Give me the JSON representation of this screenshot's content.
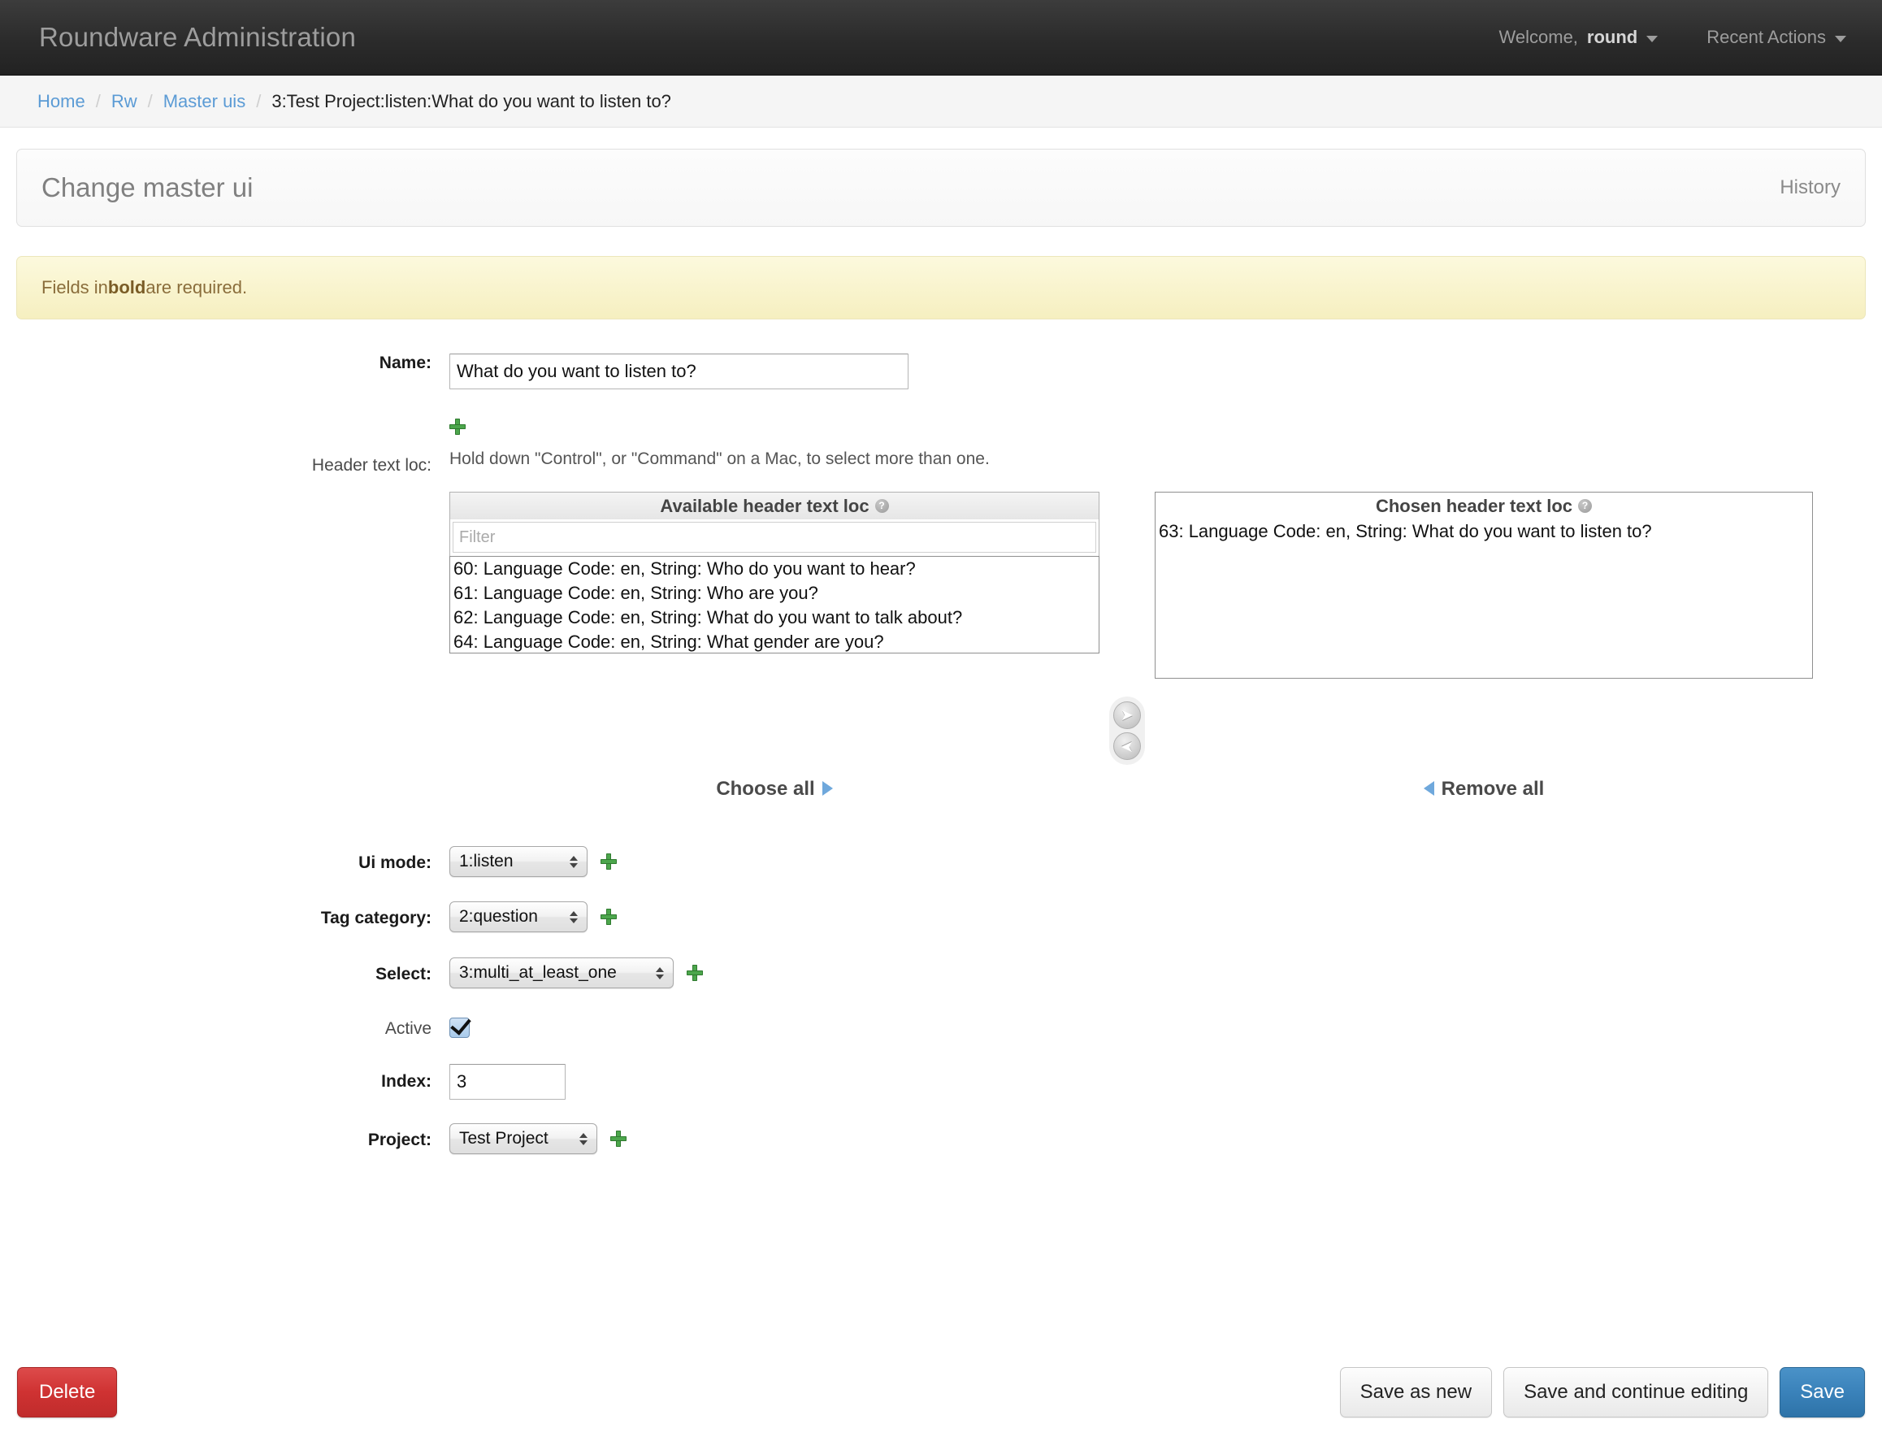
{
  "topnav": {
    "brand": "Roundware Administration",
    "welcome_prefix": "Welcome,",
    "username": "round",
    "recent_actions": "Recent Actions"
  },
  "breadcrumb": {
    "home": "Home",
    "app": "Rw",
    "model": "Master uis",
    "current": "3:Test Project:listen:What do you want to listen to?",
    "separator": "/"
  },
  "page": {
    "title": "Change master ui",
    "history_link": "History",
    "required_notice_pre": "Fields in ",
    "required_notice_bold": "bold",
    "required_notice_post": " are required."
  },
  "fields": {
    "name": {
      "label": "Name:",
      "value": "What do you want to listen to?"
    },
    "header_text_loc": {
      "label": "Header text loc:",
      "add_icon": "plus-icon",
      "help_text": "Hold down \"Control\", or \"Command\" on a Mac, to select more than one.",
      "available_title": "Available header text loc",
      "chosen_title": "Chosen header text loc",
      "filter_placeholder": "Filter",
      "filter_value": "",
      "available_options": [
        "60: Language Code: en, String: Who do you want to hear?",
        "61: Language Code: en, String: Who are you?",
        "62: Language Code: en, String: What do you want to talk about?",
        "64: Language Code: en, String: What gender are you?"
      ],
      "chosen_options": [
        "63: Language Code: en, String: What do you want to listen to?"
      ],
      "choose_all": "Choose all",
      "remove_all": "Remove all",
      "add_arrow": "arrow-right-icon",
      "remove_arrow": "arrow-left-icon"
    },
    "ui_mode": {
      "label": "Ui mode:",
      "value": "1:listen"
    },
    "tag_category": {
      "label": "Tag category:",
      "value": "2:question"
    },
    "select": {
      "label": "Select:",
      "value": "3:multi_at_least_one"
    },
    "active": {
      "label": "Active",
      "checked": true
    },
    "index": {
      "label": "Index:",
      "value": "3"
    },
    "project": {
      "label": "Project:",
      "value": "Test Project"
    }
  },
  "buttons": {
    "delete": "Delete",
    "save_as_new": "Save as new",
    "save_and_continue": "Save and continue editing",
    "save": "Save"
  },
  "colors": {
    "link": "#5b9bd5",
    "primary": "#3a82ba",
    "danger": "#cf3232",
    "add_icon": "#4ca64c",
    "warning_bg": "#f6efc0"
  }
}
